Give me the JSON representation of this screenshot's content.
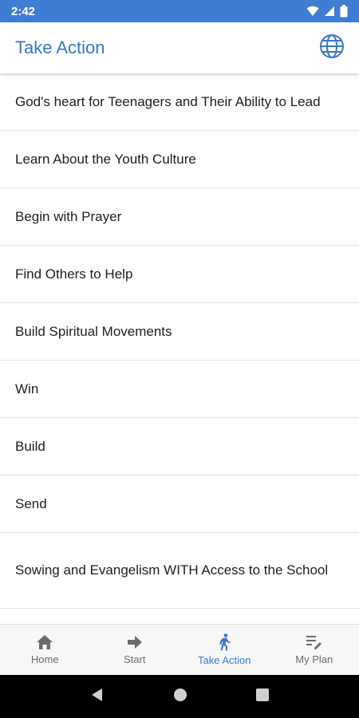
{
  "status": {
    "time": "2:42",
    "icons": [
      "wifi-icon",
      "signal-icon",
      "battery-icon"
    ]
  },
  "header": {
    "title": "Take Action",
    "action_icon": "globe-icon"
  },
  "list": {
    "items": [
      {
        "label": "God's heart for Teenagers and Their Ability to Lead"
      },
      {
        "label": "Learn About the Youth Culture"
      },
      {
        "label": "Begin with Prayer"
      },
      {
        "label": "Find Others to Help"
      },
      {
        "label": "Build Spiritual Movements"
      },
      {
        "label": "Win"
      },
      {
        "label": "Build"
      },
      {
        "label": "Send"
      },
      {
        "label": "Sowing and Evangelism WITH Access to the School"
      }
    ]
  },
  "bottom_nav": {
    "items": [
      {
        "label": "Home",
        "icon": "home-icon"
      },
      {
        "label": "Start",
        "icon": "arrow-right-icon"
      },
      {
        "label": "Take Action",
        "icon": "walking-icon",
        "active": true
      },
      {
        "label": "My Plan",
        "icon": "edit-list-icon"
      }
    ]
  },
  "colors": {
    "status_bar": "#3f7dd4",
    "accent": "#3a78c8",
    "text": "#202020",
    "nav_inactive": "#6b6b6b"
  }
}
